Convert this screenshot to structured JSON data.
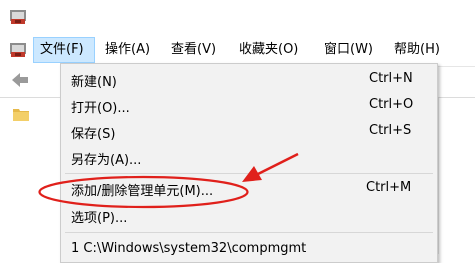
{
  "window": {
    "icon": "computer-management-icon"
  },
  "menubar": {
    "system_icon": "computer-management-icon",
    "items": [
      {
        "label": "文件(F)"
      },
      {
        "label": "操作(A)"
      },
      {
        "label": "查看(V)"
      },
      {
        "label": "收藏夹(O)"
      },
      {
        "label": "窗口(W)"
      },
      {
        "label": "帮助(H)"
      }
    ]
  },
  "toolbar": {
    "back_icon": "back-arrow-icon"
  },
  "tree": {
    "folder_icon": "folder-icon"
  },
  "file_menu": {
    "items": [
      {
        "label": "新建(N)",
        "shortcut": "Ctrl+N"
      },
      {
        "label": "打开(O)...",
        "shortcut": "Ctrl+O"
      },
      {
        "label": "保存(S)",
        "shortcut": "Ctrl+S"
      },
      {
        "label": "另存为(A)..."
      },
      {
        "label": "添加/删除管理单元(M)...",
        "shortcut": "Ctrl+M"
      },
      {
        "label": "选项(P)..."
      },
      {
        "label": "1 C:\\Windows\\system32\\compmgmt"
      }
    ]
  },
  "annotation": {
    "highlight_color": "#e0201b"
  }
}
